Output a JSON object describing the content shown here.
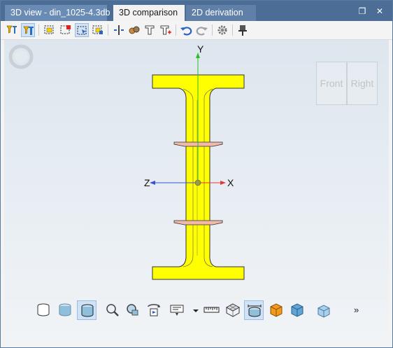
{
  "tabs": [
    {
      "label": "3D view - din_1025-4.3db",
      "active": false
    },
    {
      "label": "3D comparison",
      "active": true
    },
    {
      "label": "2D derivation",
      "active": false
    }
  ],
  "window_controls": {
    "maximize": "❐",
    "close": "✕"
  },
  "view_cube": {
    "front": "Front",
    "right": "Right"
  },
  "axes": {
    "x": "X",
    "y": "Y",
    "z": "Z"
  },
  "bottom_more": "»",
  "colors": {
    "beam": "#ffff00",
    "plate": "#f2b8a8",
    "accent": "#4c6e96",
    "x_axis": "#e53935",
    "y_axis": "#2bbd2b",
    "z_axis": "#3b4fd9"
  }
}
